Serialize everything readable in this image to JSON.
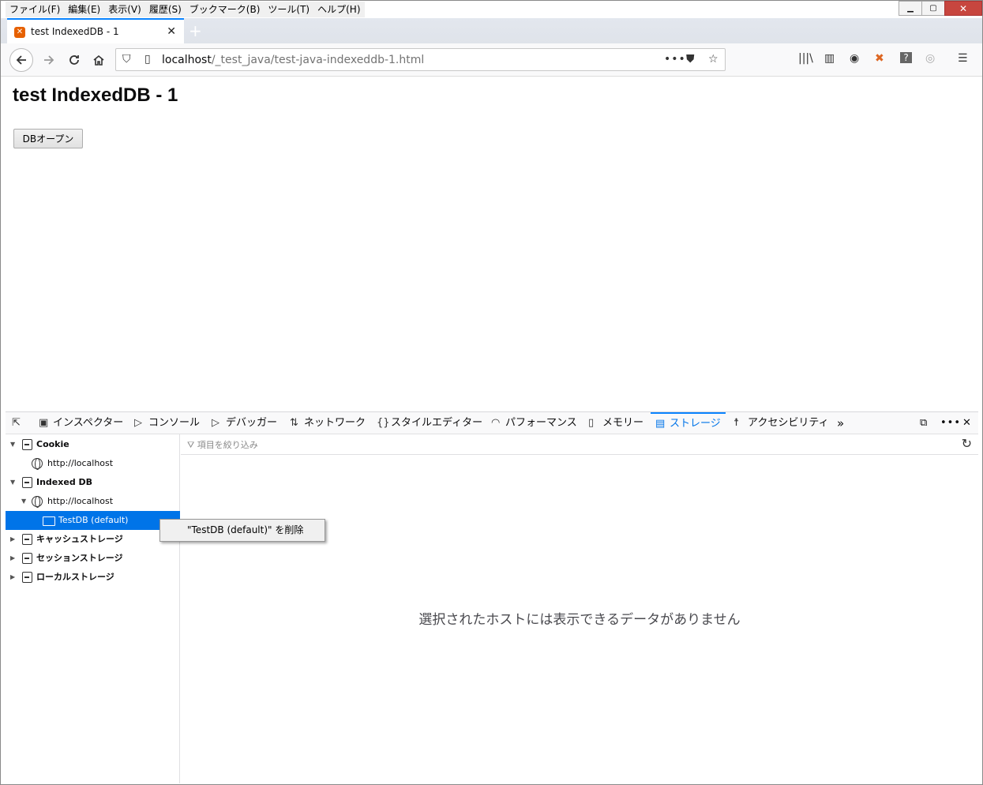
{
  "menu": [
    "ファイル(F)",
    "編集(E)",
    "表示(V)",
    "履歴(S)",
    "ブックマーク(B)",
    "ツール(T)",
    "ヘルプ(H)"
  ],
  "tab": {
    "title": "test IndexedDB - 1",
    "close": "✕",
    "new": "+"
  },
  "urlbar": {
    "host": "localhost",
    "path": "/_test_java/test-java-indexeddb-1.html"
  },
  "page": {
    "heading": "test IndexedDB - 1",
    "button": "DBオープン"
  },
  "devtools": {
    "tabs": [
      "インスペクター",
      "コンソール",
      "デバッガー",
      "ネットワーク",
      "スタイルエディター",
      "パフォーマンス",
      "メモリー",
      "ストレージ",
      "アクセシビリティ"
    ],
    "selected_tab": "ストレージ",
    "tree": {
      "cookie": "Cookie",
      "cookie_host": "http://localhost",
      "indexeddb": "Indexed DB",
      "idb_host": "http://localhost",
      "idb_db": "TestDB (default)",
      "cache": "キャッシュストレージ",
      "session": "セッションストレージ",
      "local": "ローカルストレージ"
    },
    "filter_placeholder": "項目を絞り込み",
    "empty_message": "選択されたホストには表示できるデータがありません",
    "context_menu": "\"TestDB (default)\" を削除"
  }
}
